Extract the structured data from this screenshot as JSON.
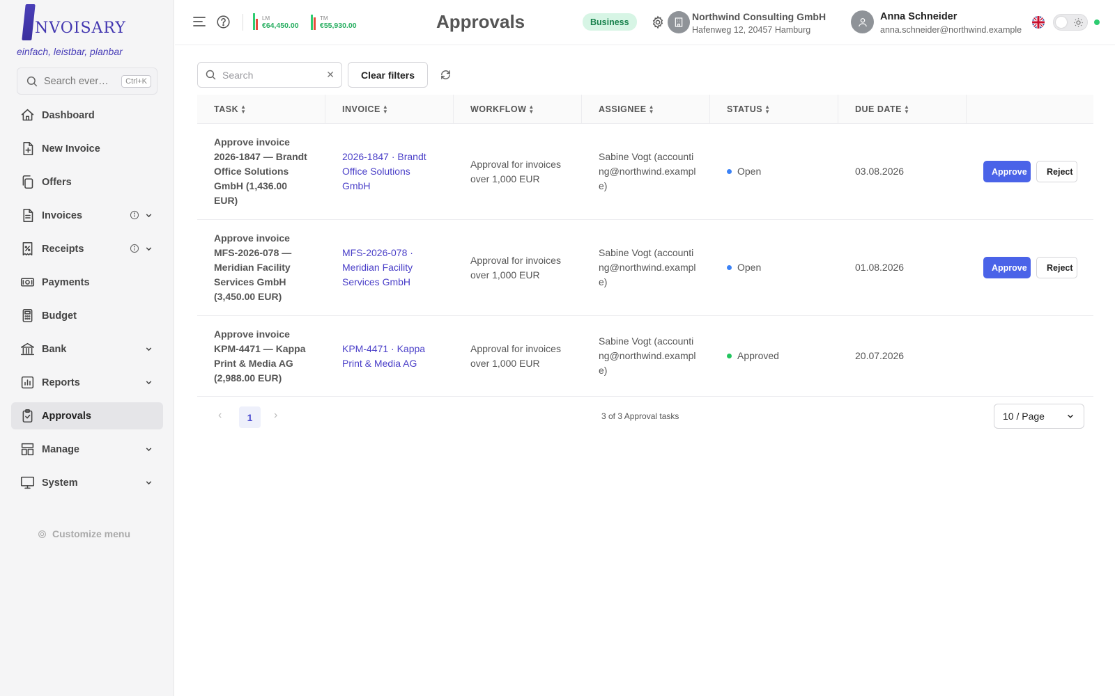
{
  "brand": {
    "name": "NVOISARY",
    "tagline": "einfach, leistbar, planbar"
  },
  "sidebar": {
    "search_placeholder": "Search ever…",
    "search_shortcut": "Ctrl+K",
    "items": [
      {
        "label": "Dashboard",
        "icon": "home-icon"
      },
      {
        "label": "New Invoice",
        "icon": "file-plus-icon"
      },
      {
        "label": "Offers",
        "icon": "copy-icon"
      },
      {
        "label": "Invoices",
        "icon": "file-icon",
        "info": true,
        "expandable": true
      },
      {
        "label": "Receipts",
        "icon": "receipt-percent-icon",
        "info": true,
        "expandable": true
      },
      {
        "label": "Payments",
        "icon": "money-icon"
      },
      {
        "label": "Budget",
        "icon": "calculator-icon"
      },
      {
        "label": "Bank",
        "icon": "bank-icon",
        "expandable": true
      },
      {
        "label": "Reports",
        "icon": "chart-icon",
        "expandable": true
      },
      {
        "label": "Approvals",
        "icon": "clipboard-check-icon",
        "active": true
      },
      {
        "label": "Manage",
        "icon": "layout-icon",
        "expandable": true
      },
      {
        "label": "System",
        "icon": "monitor-icon",
        "expandable": true
      }
    ],
    "customize_label": "Customize menu"
  },
  "header": {
    "kpis": [
      {
        "key": "LM",
        "value": "€64,450.00"
      },
      {
        "key": "TM",
        "value": "€55,930.00"
      }
    ],
    "title": "Approvals",
    "plan_badge": "Business",
    "company": {
      "name": "Northwind Consulting GmbH",
      "address": "Hafenweg 12, 20457 Hamburg"
    },
    "user": {
      "name": "Anna Schneider",
      "email": "anna.schneider@northwind.example"
    },
    "colors": {
      "accent": "#4a63e8",
      "positive": "#27ae60",
      "kpi_bar_green": "#2ecc71",
      "kpi_bar_red": "#e74c3c"
    }
  },
  "toolbar": {
    "search_placeholder": "Search",
    "search_value": "",
    "clear_filters_label": "Clear filters"
  },
  "table": {
    "columns": [
      "TASK",
      "INVOICE",
      "WORKFLOW",
      "ASSIGNEE",
      "STATUS",
      "DUE DATE"
    ],
    "rows": [
      {
        "task": "Approve invoice 2026-1847 — Brandt Office Solutions GmbH (1,436.00 EUR)",
        "invoice": "2026-1847 · Brandt Office Solutions GmbH",
        "workflow": "Approval for invoices over 1,000 EUR",
        "assignee": "Sabine Vogt (accounting@northwind.example)",
        "status": "Open",
        "status_color": "#3b82f6",
        "due_date": "03.08.2026",
        "actions": {
          "approve": "Approve",
          "reject": "Reject"
        }
      },
      {
        "task": "Approve invoice MFS-2026-078 — Meridian Facility Services GmbH (3,450.00 EUR)",
        "invoice": "MFS-2026-078 · Meridian Facility Services GmbH",
        "workflow": "Approval for invoices over 1,000 EUR",
        "assignee": "Sabine Vogt (accounting@northwind.example)",
        "status": "Open",
        "status_color": "#3b82f6",
        "due_date": "01.08.2026",
        "actions": {
          "approve": "Approve",
          "reject": "Reject"
        }
      },
      {
        "task": "Approve invoice KPM-4471 — Kappa Print & Media AG (2,988.00 EUR)",
        "invoice": "KPM-4471 · Kappa Print & Media AG",
        "workflow": "Approval for invoices over 1,000 EUR",
        "assignee": "Sabine Vogt (accounting@northwind.example)",
        "status": "Approved",
        "status_color": "#22c55e",
        "due_date": "20.07.2026",
        "actions": null
      }
    ]
  },
  "pagination": {
    "current_page": "1",
    "total_text": "3 of 3 Approval tasks",
    "page_size": "10 / Page"
  }
}
